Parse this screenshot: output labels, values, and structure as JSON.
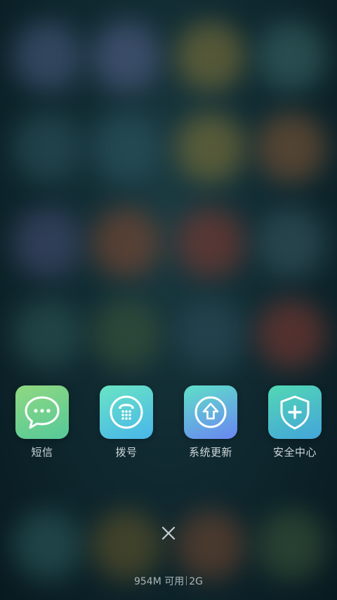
{
  "recent_apps": [
    {
      "label": "短信",
      "icon": "message-bubble-icon",
      "gradient": [
        "#8fd880",
        "#4fc7a0"
      ]
    },
    {
      "label": "拨号",
      "icon": "rotary-phone-icon",
      "gradient": [
        "#68e0c8",
        "#4ab9e8"
      ]
    },
    {
      "label": "系统更新",
      "icon": "upload-arrow-icon",
      "gradient": [
        "#5ed8d0",
        "#6a8ef0"
      ]
    },
    {
      "label": "安全中心",
      "icon": "shield-plus-icon",
      "gradient": [
        "#4fd3b8",
        "#46a8d8"
      ]
    }
  ],
  "close_icon": "close-icon",
  "memory": {
    "available": "954M 可用",
    "total": "2G"
  },
  "colors": {
    "label_text": "#cfd8da",
    "status_text": "#a9b6b9",
    "background": "#102a31"
  }
}
